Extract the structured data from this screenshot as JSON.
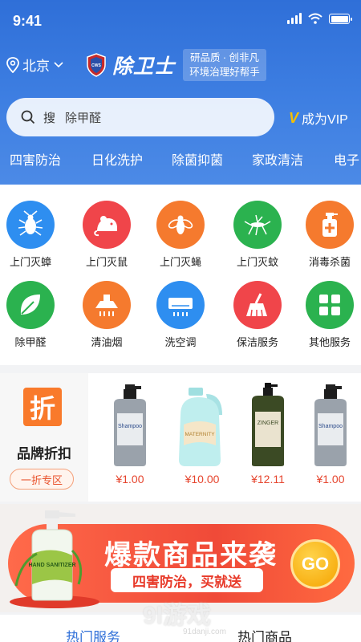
{
  "status_bar": {
    "time": "9:41",
    "battery_level": 1.0
  },
  "header": {
    "city": "北京",
    "brand_name": "除卫士",
    "brand_badge": "CWS",
    "slogan_line1": "研品质 · 创非凡",
    "slogan_line2": "环境治理好帮手",
    "search_prefix": "搜",
    "search_hint": "除甲醛",
    "vip_label": "成为VIP"
  },
  "categories": [
    "四害防治",
    "日化洗护",
    "除菌抑菌",
    "家政清洁",
    "电子"
  ],
  "services": [
    {
      "label": "上门灭蟑",
      "icon": "cockroach-icon",
      "color": "#2e8ef0"
    },
    {
      "label": "上门灭鼠",
      "icon": "mouse-icon",
      "color": "#f0454a"
    },
    {
      "label": "上门灭蝇",
      "icon": "fly-icon",
      "color": "#f57a2e"
    },
    {
      "label": "上门灭蚊",
      "icon": "mosquito-icon",
      "color": "#2bb24f"
    },
    {
      "label": "消毒杀菌",
      "icon": "disinfect-bottle-icon",
      "color": "#f57a2e"
    },
    {
      "label": "除甲醛",
      "icon": "leaf-icon",
      "color": "#2bb24f"
    },
    {
      "label": "清油烟",
      "icon": "range-hood-icon",
      "color": "#f57a2e"
    },
    {
      "label": "洗空调",
      "icon": "air-conditioner-icon",
      "color": "#2e8ef0"
    },
    {
      "label": "保洁服务",
      "icon": "broom-icon",
      "color": "#f0454a"
    },
    {
      "label": "其他服务",
      "icon": "grid-icon",
      "color": "#2bb24f"
    }
  ],
  "discount": {
    "icon_char": "折",
    "title": "品牌折扣",
    "pill": "一折专区",
    "products": [
      {
        "label": "Shampoo",
        "price": "¥1.00"
      },
      {
        "label": "MATERNITY",
        "price": "¥10.00"
      },
      {
        "label": "ZINGER",
        "price": "¥12.11"
      },
      {
        "label": "Shampoo",
        "price": "¥1.00"
      }
    ]
  },
  "banner": {
    "title": "爆款商品来袭",
    "subtitle": "四害防治，买就送",
    "button": "GO",
    "bottle_text": "HAND SANITIZER"
  },
  "bottom_tabs": [
    "热门服务",
    "热门商品"
  ],
  "watermark": {
    "main": "9l游戏",
    "sub": "91danji.com"
  },
  "colors": {
    "primary": "#2f6fd8",
    "accent": "#f57a2e",
    "price": "#e6452e",
    "vip": "#f5c000"
  }
}
